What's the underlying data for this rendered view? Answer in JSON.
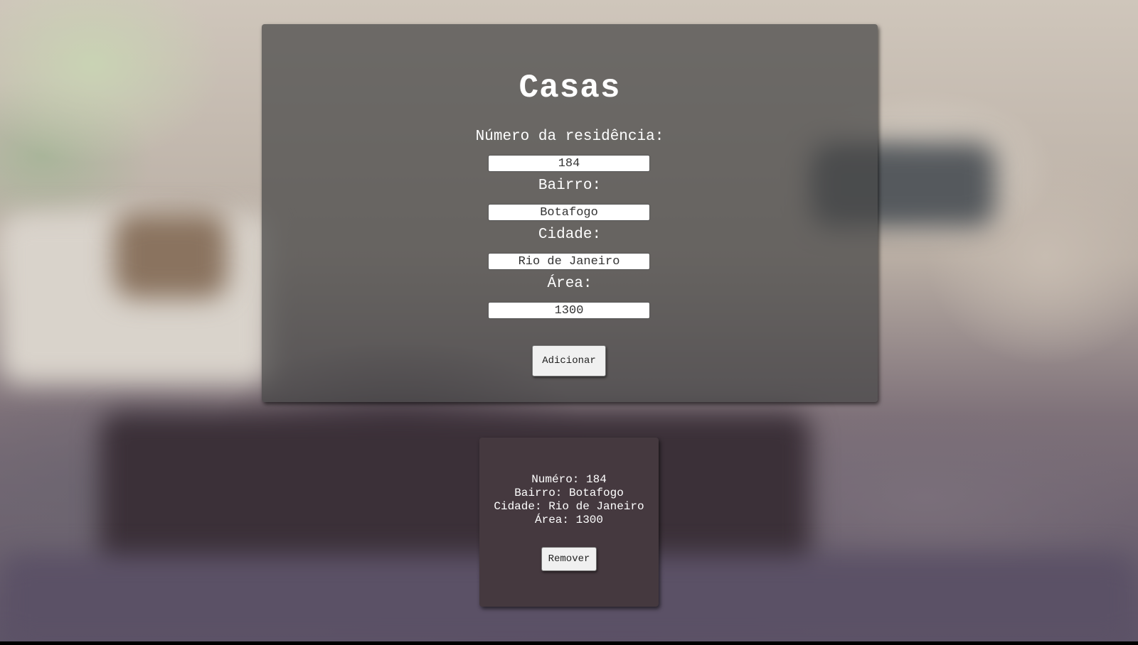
{
  "form": {
    "title": "Casas",
    "fields": [
      {
        "label": "Número da residência:",
        "value": "184"
      },
      {
        "label": "Bairro:",
        "value": "Botafogo"
      },
      {
        "label": "Cidade:",
        "value": "Rio de Janeiro"
      },
      {
        "label": "Área:",
        "value": "1300"
      }
    ],
    "add_label": "Adicionar"
  },
  "houses": [
    {
      "numero": "Numéro: 184",
      "bairro": "Bairro: Botafogo",
      "cidade": "Cidade: Rio de Janeiro",
      "area": "Área: 1300",
      "remove_label": "Remover"
    }
  ],
  "colors": {
    "form_panel": "#464646",
    "house_card": "#45393f",
    "button_bg": "#f0f0f0",
    "text": "#ffffff"
  }
}
